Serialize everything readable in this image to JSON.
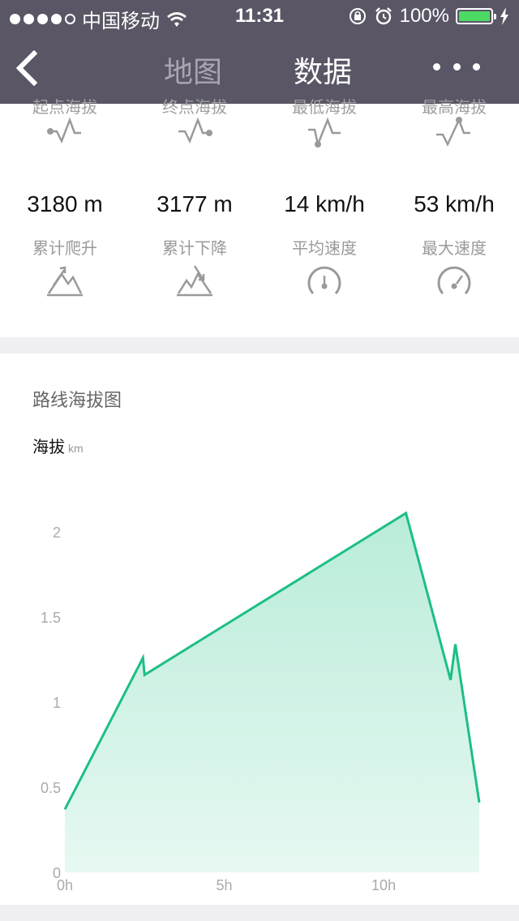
{
  "status_bar": {
    "carrier": "中国移动",
    "time": "11:31",
    "battery": "100%"
  },
  "nav": {
    "tabs": [
      {
        "label": "地图",
        "active": false
      },
      {
        "label": "数据",
        "active": true
      }
    ]
  },
  "stats": {
    "top_row_labels": [
      "起点海拔",
      "终点海拔",
      "最低海拔",
      "最高海拔"
    ],
    "items": [
      {
        "value": "3180 m",
        "label": "累计爬升"
      },
      {
        "value": "3177 m",
        "label": "累计下降"
      },
      {
        "value": "14 km/h",
        "label": "平均速度"
      },
      {
        "value": "53 km/h",
        "label": "最大速度"
      }
    ]
  },
  "chart": {
    "title": "路线海拔图",
    "ylabel": "海拔",
    "yunit": "km"
  },
  "chart_data": {
    "type": "area",
    "ylabel": "海拔 km",
    "xlim": [
      0,
      13
    ],
    "ylim": [
      0,
      2
    ],
    "yticks": [
      "0",
      "0.5",
      "1",
      "1.5",
      "2"
    ],
    "xticks": [
      "0h",
      "5h",
      "10h"
    ],
    "series": [
      {
        "x": [
          0,
          2.45,
          2.5,
          10.7,
          12.1,
          12.25,
          13.0
        ],
        "y": [
          0.37,
          1.26,
          1.16,
          2.11,
          1.13,
          1.34,
          0.41
        ]
      }
    ],
    "line_color": "#1dbf84",
    "fill_color": "#b9ecd9"
  }
}
